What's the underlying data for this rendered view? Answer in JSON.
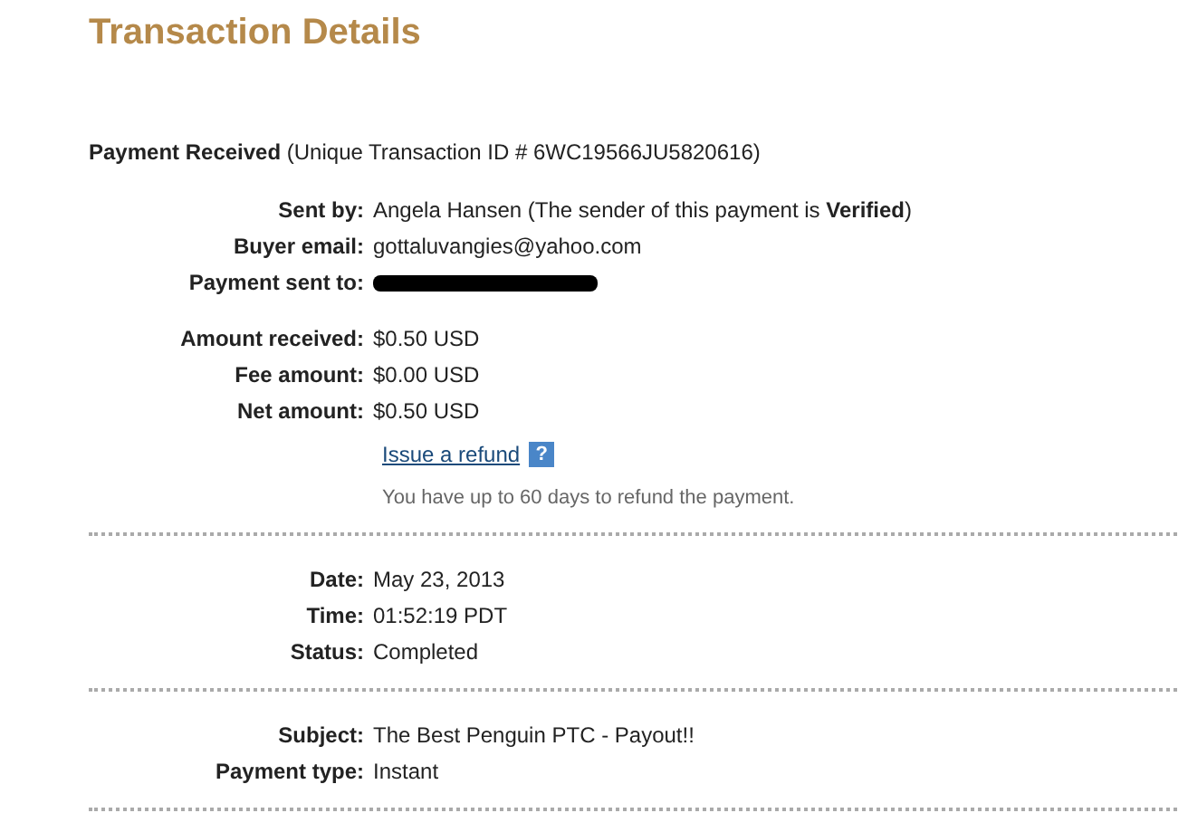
{
  "title": "Transaction Details",
  "header": "**Payment Received** (Unique Transaction ID # 6WC19566JU5820616)",
  "sections": [
    {
      "groups": [
        [
          {
            "kind": "text",
            "label": "Sent by:",
            "value": "Angela Hansen (The sender of this payment is **Verified**)"
          },
          {
            "kind": "text",
            "label": "Buyer email:",
            "value": "gottaluvangies@yahoo.com"
          },
          {
            "kind": "redacted",
            "label": "Payment sent to:"
          }
        ],
        [
          {
            "kind": "text",
            "label": "Amount received:",
            "value": "$0.50 USD"
          },
          {
            "kind": "text",
            "label": "Fee amount:",
            "value": "$0.00 USD"
          },
          {
            "kind": "text",
            "label": "Net amount:",
            "value": "$0.50 USD"
          }
        ]
      ],
      "refund": {
        "link": "Issue a refund",
        "help": "?",
        "note": "You have up to 60 days to refund the payment."
      }
    },
    {
      "groups": [
        [
          {
            "kind": "text",
            "label": "Date:",
            "value": "May 23, 2013"
          },
          {
            "kind": "text",
            "label": "Time:",
            "value": "01:52:19 PDT"
          },
          {
            "kind": "text",
            "label": "Status:",
            "value": "Completed"
          }
        ]
      ]
    },
    {
      "groups": [
        [
          {
            "kind": "text",
            "label": "Subject:",
            "value": "The Best Penguin PTC - Payout!!"
          },
          {
            "kind": "text",
            "label": "Payment type:",
            "value": "Instant"
          }
        ]
      ]
    }
  ]
}
